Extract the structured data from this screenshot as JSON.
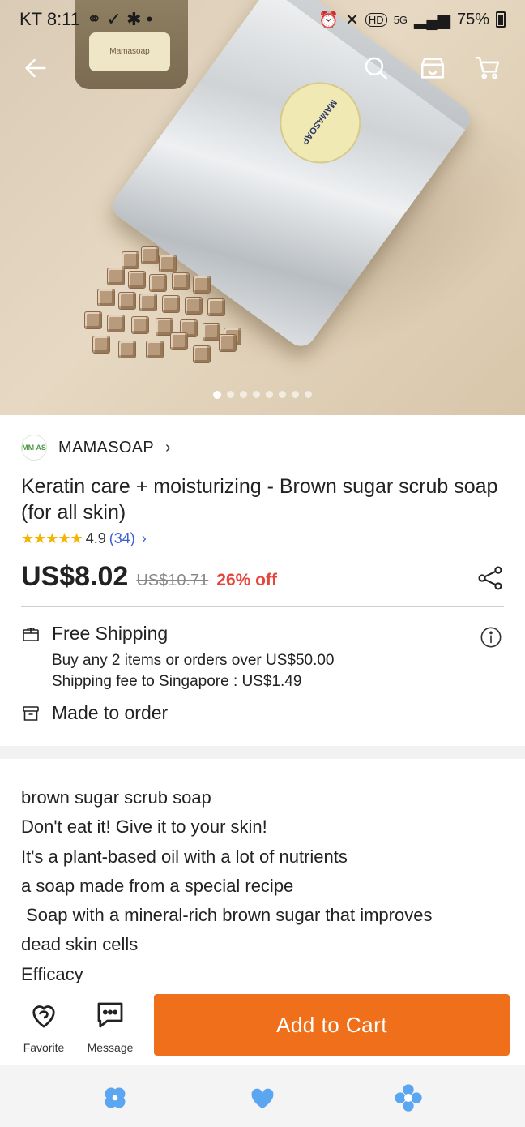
{
  "status_bar": {
    "carrier_time": "KT 8:11",
    "battery": "75%",
    "indicators": [
      "alarm-icon",
      "mute-icon",
      "hd-icon",
      "5g-icon",
      "signal-icon"
    ]
  },
  "top_nav": {
    "back": "back-arrow-icon",
    "search": "search-icon",
    "store": "store-icon",
    "cart": "cart-icon"
  },
  "hero": {
    "jar_label": "Mamasoap",
    "pouch_label": "MAMASOAP",
    "image_count": 8,
    "active_index": 0
  },
  "product": {
    "seller_name": "MAMASOAP",
    "seller_logo_text": "MM AS",
    "title": "Keratin care + moisturizing - Brown sugar scrub soap (for all skin)",
    "stars": "★★★★★",
    "rating": "4.9",
    "review_count": "(34)",
    "price": "US$8.02",
    "original_price": "US$10.71",
    "discount": "26% off"
  },
  "shipping": {
    "title": "Free Shipping",
    "condition": "Buy any 2 items or orders over US$50.00",
    "fee": "Shipping fee to Singapore : US$1.49",
    "made_to_order": "Made to order"
  },
  "description": [
    "brown sugar scrub soap",
    "Don't eat it! Give it to your skin!",
    "It's a plant-based oil with a lot of nutrients",
    "a soap made from a special recipe",
    " Soap with a mineral-rich brown sugar that improves",
    "dead skin cells",
    "Efficacy"
  ],
  "actions": {
    "favorite": "Favorite",
    "message": "Message",
    "add_to_cart": "Add to Cart"
  },
  "colors": {
    "accent": "#ef6f1a",
    "discount": "#e8443a",
    "link": "#3e5fd0",
    "star": "#f5b400",
    "system_icon": "#5aa6f0"
  }
}
